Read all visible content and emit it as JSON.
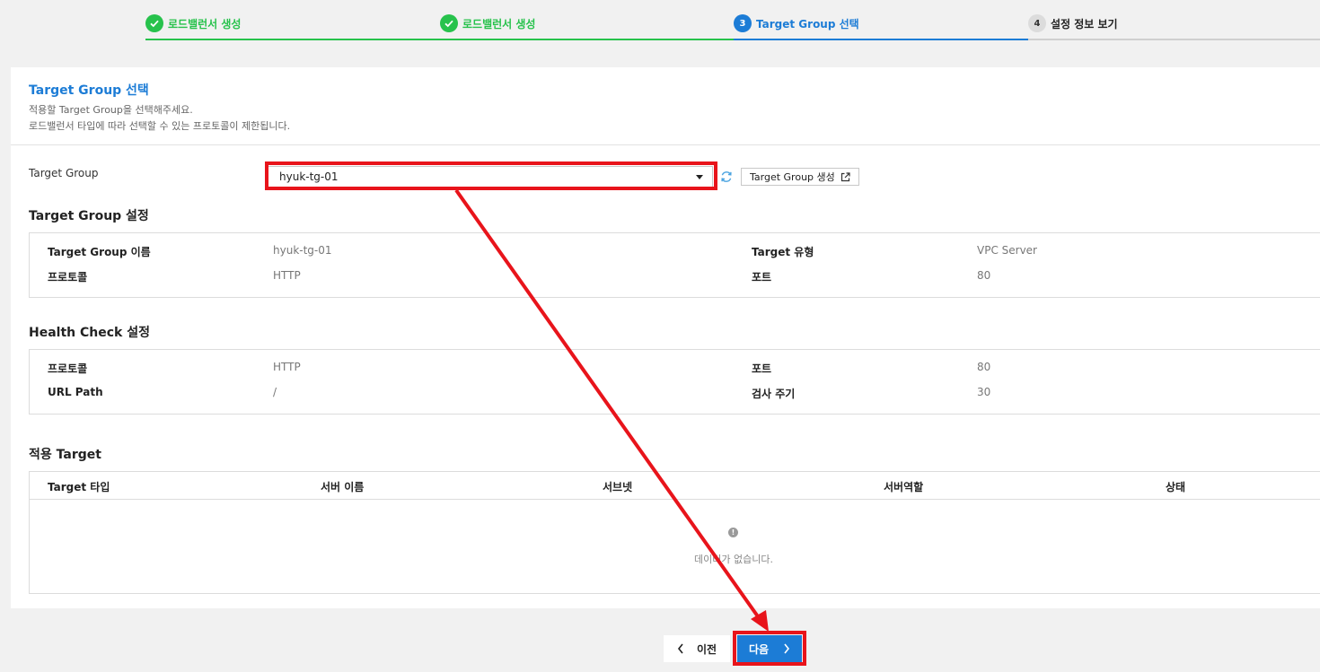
{
  "stepper": {
    "steps": [
      {
        "number": "1",
        "label": "로드밸런서 생성",
        "state": "done"
      },
      {
        "number": "2",
        "label": "로드밸런서 생성",
        "state": "done"
      },
      {
        "number": "3",
        "label": "Target Group 선택",
        "state": "active"
      },
      {
        "number": "4",
        "label": "설정 정보 보기",
        "state": "todo"
      }
    ]
  },
  "panel": {
    "title": "Target Group 선택",
    "desc1": "적용할 Target Group을 선택해주세요.",
    "desc2": "로드밸런서 타입에 따라 선택할 수 있는 프로토콜이 제한됩니다."
  },
  "target_group": {
    "label": "Target Group",
    "selected": "hyuk-tg-01",
    "create_label": "Target Group 생성"
  },
  "tg_settings": {
    "title": "Target Group 설정",
    "name_key": "Target Group 이름",
    "name_val": "hyuk-tg-01",
    "type_key": "Target 유형",
    "type_val": "VPC Server",
    "protocol_key": "프로토콜",
    "protocol_val": "HTTP",
    "port_key": "포트",
    "port_val": "80"
  },
  "health_check": {
    "title": "Health Check 설정",
    "protocol_key": "프로토콜",
    "protocol_val": "HTTP",
    "port_key": "포트",
    "port_val": "80",
    "path_key": "URL Path",
    "path_val": "/",
    "interval_key": "검사 주기",
    "interval_val": "30"
  },
  "applied_targets": {
    "title": "적용 Target",
    "columns": [
      "Target 타입",
      "서버 이름",
      "서브넷",
      "서버역할",
      "상태"
    ],
    "empty_icon": "!",
    "empty_text": "데이터가 없습니다."
  },
  "footer": {
    "prev_label": "이전",
    "next_label": "다음"
  },
  "colors": {
    "done": "#27c24c",
    "active": "#1c7cd6",
    "annotation": "#e8141b"
  }
}
